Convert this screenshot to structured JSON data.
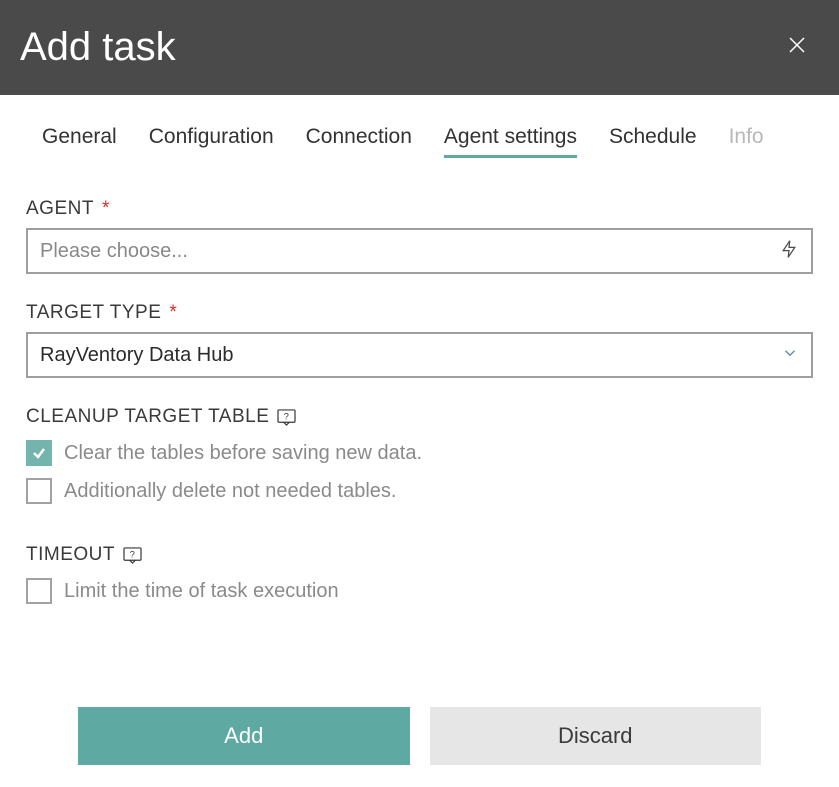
{
  "header": {
    "title": "Add task"
  },
  "tabs": [
    {
      "label": "General",
      "active": false,
      "disabled": false
    },
    {
      "label": "Configuration",
      "active": false,
      "disabled": false
    },
    {
      "label": "Connection",
      "active": false,
      "disabled": false
    },
    {
      "label": "Agent settings",
      "active": true,
      "disabled": false
    },
    {
      "label": "Schedule",
      "active": false,
      "disabled": false
    },
    {
      "label": "Info",
      "active": false,
      "disabled": true
    }
  ],
  "fields": {
    "agent": {
      "label": "AGENT",
      "required": true,
      "placeholder": "Please choose...",
      "value": ""
    },
    "target_type": {
      "label": "TARGET TYPE",
      "required": true,
      "value": "RayVentory Data Hub"
    },
    "cleanup": {
      "label": "CLEANUP TARGET TABLE",
      "options": [
        {
          "label": "Clear the tables before saving new data.",
          "checked": true
        },
        {
          "label": "Additionally delete not needed tables.",
          "checked": false
        }
      ]
    },
    "timeout": {
      "label": "TIMEOUT",
      "option": {
        "label": "Limit the time of task execution",
        "checked": false
      }
    }
  },
  "footer": {
    "primary": "Add",
    "secondary": "Discard"
  },
  "required_marker": "*"
}
